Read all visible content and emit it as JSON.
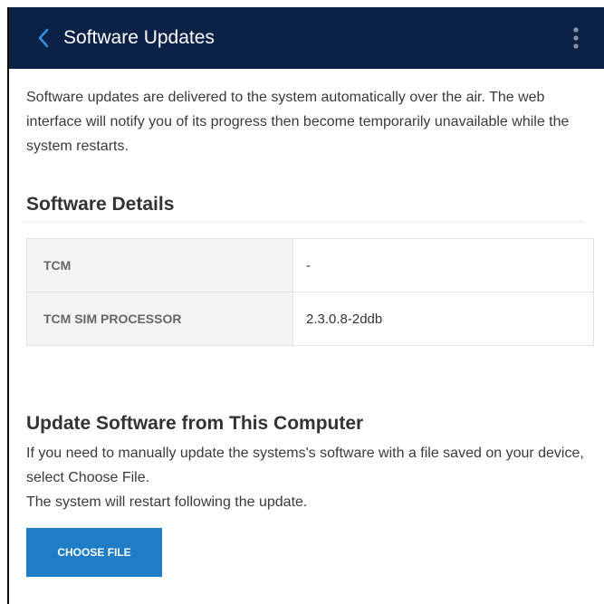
{
  "header": {
    "title": "Software Updates",
    "back_icon": "chevron-left-icon",
    "menu_icon": "vertical-dots-icon"
  },
  "intro": "Software updates are delivered to the system automatically over the air. The web interface will notify you of its progress then become temporarily unavailable while the system restarts.",
  "details": {
    "title": "Software Details",
    "rows": [
      {
        "label": "TCM",
        "value": "-"
      },
      {
        "label": "TCM SIM PROCESSOR",
        "value": "2.3.0.8-2ddb"
      }
    ]
  },
  "update": {
    "title": "Update Software from This Computer",
    "line1": "If you need to manually update the systems's software with a file saved on your device, select Choose File.",
    "line2": "The system will restart following the update.",
    "button_label": "CHOOSE FILE"
  },
  "colors": {
    "header_bg": "#0c2146",
    "accent": "#1f7dc5",
    "back_icon": "#2f8ee0"
  }
}
